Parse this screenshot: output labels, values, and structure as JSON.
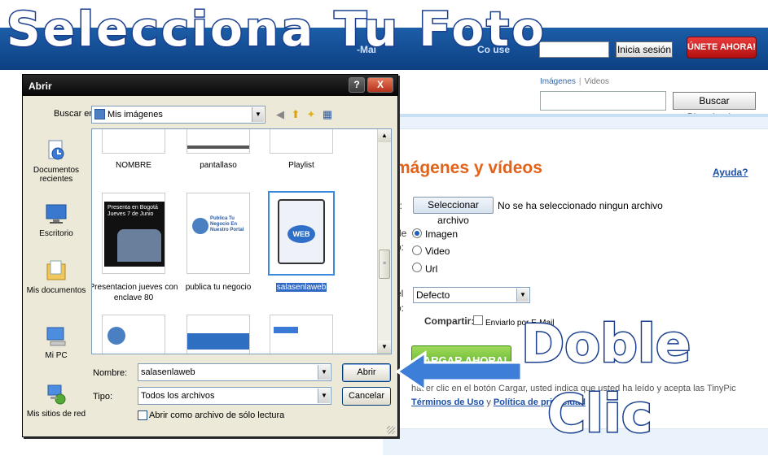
{
  "overlay": {
    "title": "Selecciona Tu Foto",
    "doble": "Doble",
    "clic": "Clic"
  },
  "site": {
    "email_label": "-Mai",
    "password_label": "Co   use",
    "login_button": "Inicia sesión",
    "join_button": "ÚNETE AHORA!",
    "search_tab_images": "Imágenes",
    "search_tab_separator": "|",
    "search_tab_videos": "Videos",
    "search_button": "Buscar Photobucket",
    "heading": "mágenes y vídeos",
    "help_link": "Ayuda?",
    "frag_file": "o:",
    "frag_type1": "de",
    "frag_type2": "o:",
    "frag_size1": "el",
    "frag_size2": "o:",
    "select_file_button": "Seleccionar archivo",
    "no_file_text": "No se ha seleccionado ningun archivo",
    "media_options": [
      "Imagen",
      "Video",
      "Url"
    ],
    "size_select": "Defecto",
    "share_label": "Compartir:",
    "share_option": "Enviarlo por E-Mail",
    "upload_button": "CARGAR AHORA!",
    "legal_text": "hacer clic en el botón Cargar, usted indica que usted ha leído y acepta las TinyPic",
    "terms_link": "Términos de Uso",
    "legal_and": "y",
    "privacy_link": "Política de privacidad"
  },
  "dialog": {
    "title": "Abrir",
    "help_button": "?",
    "close_button": "X",
    "look_in_label": "Buscar en:",
    "look_in_value": "Mis imágenes",
    "places": [
      "Documentos recientes",
      "Escritorio",
      "Mis documentos",
      "Mi PC",
      "Mis sitios de red"
    ],
    "files_row1": [
      "NOMBRE",
      "pantallaso",
      "Playlist"
    ],
    "files_row2": [
      "Presentacion jueves con enclave 80",
      "publica tu negocio",
      "salasenlaweb"
    ],
    "thumb_text_presentacion": "Presenta en Bogotá Jueves 7 de Junio",
    "thumb_text_publica": "Publica Tu Negocio En Nuestro Portal",
    "thumb_text_web": "WEB",
    "filename_label": "Nombre:",
    "filename_value": "salasenlaweb",
    "filetype_label": "Tipo:",
    "filetype_value": "Todos los archivos",
    "open_button": "Abrir",
    "cancel_button": "Cancelar",
    "readonly_label": "Abrir como archivo de sólo lectura"
  },
  "colors": {
    "overlay_stroke": "#1a3f8f",
    "heading_orange": "#e1621b",
    "upload_green": "#4da51c",
    "join_red": "#b10f0f",
    "selection_blue": "#316ac5"
  }
}
